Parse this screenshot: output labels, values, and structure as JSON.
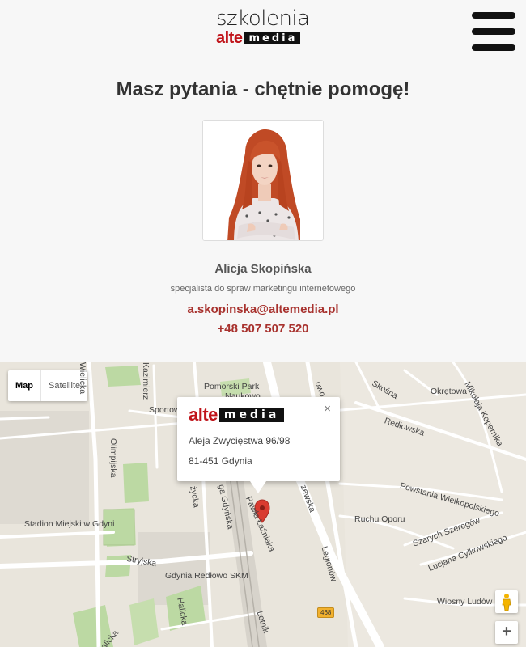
{
  "header": {
    "logo_top": "szkolenia",
    "logo_alte": "alte",
    "logo_media": "media",
    "menu_icon": "hamburger-icon"
  },
  "contact": {
    "heading": "Masz pytania - chętnie pomogę!",
    "name": "Alicja Skopińska",
    "role": "specjalista do spraw marketingu internetowego",
    "email": "a.skopinska@altemedia.pl",
    "phone": "+48 507 507 520"
  },
  "map": {
    "type_buttons": [
      "Map",
      "Satellite"
    ],
    "active_type": "Map",
    "popup": {
      "logo_alte": "alte",
      "logo_media": "media",
      "address_line1": "Aleja Zwycięstwa 96/98",
      "address_line2": "81-451 Gdynia",
      "close": "×"
    },
    "zoom_in": "+",
    "road_number": "468",
    "labels": {
      "wielicka": "Wielicka",
      "kazimierz": "Kazimierz",
      "pomorski1": "Pomorski Park",
      "pomorski2": "Naukowo",
      "sportowa": "Sportow",
      "olimpijska": "Olimpijska",
      "stadion": "Stadion Miejski w Gdyni",
      "stryjska": "Stryjska",
      "gdynia_redlowo": "Gdynia Redłowo SKM",
      "halicka1": "Halicka",
      "halicka2": "Halicka",
      "lotnik": "Lotnik",
      "zycka": "życka",
      "gdynska": "ga Gdyńska",
      "lazniaka": "Pawła Łaźniaka",
      "zwyciestwa": "zewska",
      "legionow": "Legionów",
      "nowo": "owo",
      "skosna": "Skośna",
      "okretowa": "Okrętowa",
      "kopernika": "Mikołaja Kopernika",
      "redlowska": "Redłowska",
      "powstania": "Powstania Wielkopolskiego",
      "ruchu": "Ruchu Oporu",
      "szeregow": "Szarych Szeregów",
      "cylkowskiego": "Lucjana Cylkowskiego",
      "wiosny": "Wiosny Ludów"
    }
  },
  "colors": {
    "accent": "#a8322e",
    "brand_red": "#c0141a",
    "marker": "#d93b30"
  }
}
